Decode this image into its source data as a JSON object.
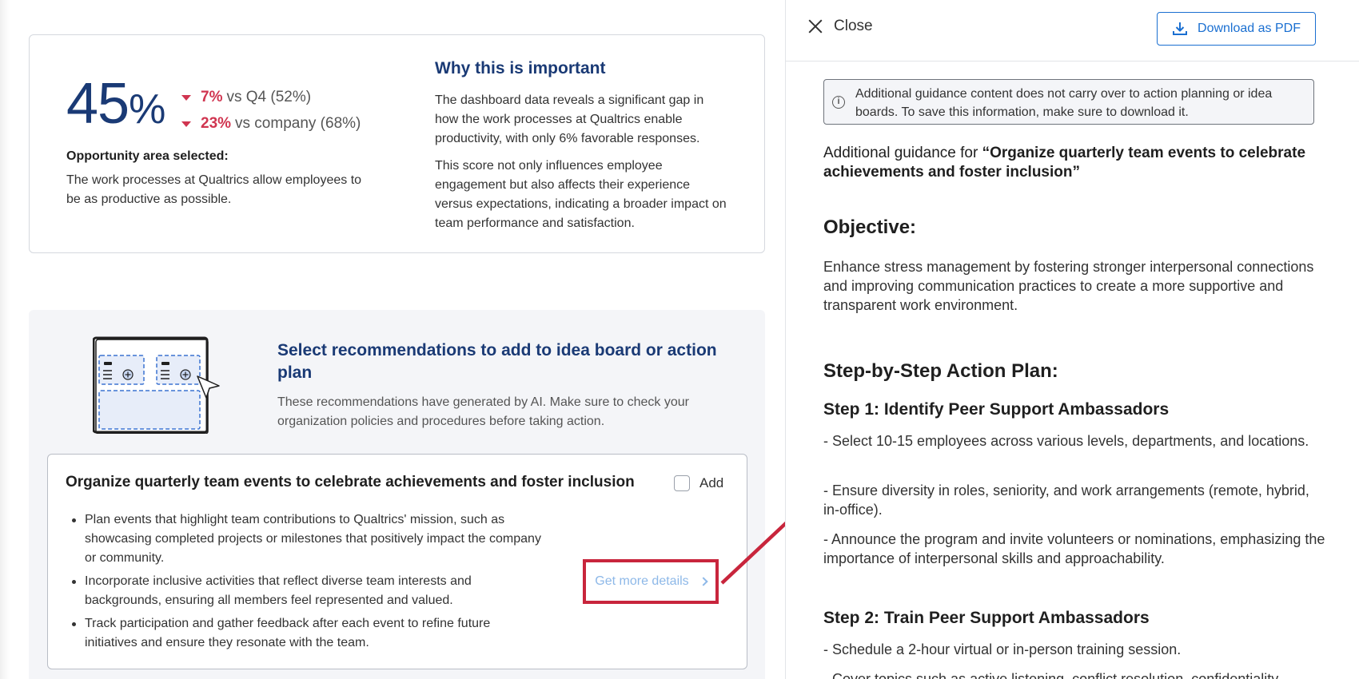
{
  "score_card": {
    "score": "45",
    "percent_sign": "%",
    "deltas": [
      {
        "value": "7%",
        "label": "vs Q4 (52%)"
      },
      {
        "value": "23%",
        "label": "vs company (68%)"
      }
    ],
    "opportunity_title": "Opportunity area selected:",
    "opportunity_text": "The work processes at Qualtrics allow employees to be as productive as possible.",
    "why_title": "Why this is important",
    "why_paragraph_1": "The dashboard data reveals a significant gap in how the work processes at Qualtrics enable productivity, with only 6% favorable responses.",
    "why_paragraph_2": "This score not only influences employee engagement but also affects their experience versus expectations, indicating a broader impact on team performance and satisfaction."
  },
  "recommendations": {
    "title": "Select recommendations to add to idea board or action plan",
    "subtitle": "These recommendations have generated by AI. Make sure to check your organization policies and procedures before taking action.",
    "card": {
      "title": "Organize quarterly team events to celebrate achievements and foster inclusion",
      "add_label": "Add",
      "bullets": [
        "Plan events that highlight team contributions to Qualtrics' mission, such as showcasing completed projects or milestones that positively impact the company or community.",
        "Incorporate inclusive activities that reflect diverse team interests and backgrounds, ensuring all members feel represented and valued.",
        "Track participation and gather feedback after each event to refine future initiatives and ensure they resonate with the team."
      ],
      "details_label": "Get more details"
    }
  },
  "side_panel": {
    "close_label": "Close",
    "download_label": "Download as PDF",
    "notice": "Additional guidance content does not carry over to action planning or idea boards. To save this information, make sure to download it.",
    "guidance_prefix": "Additional guidance for ",
    "guidance_quote": "“Organize quarterly team events to celebrate achievements and foster inclusion”",
    "objective_heading": "Objective:",
    "objective_text": "Enhance stress management by fostering stronger interpersonal connections and improving communication practices to create a more supportive and transparent work environment.",
    "plan_heading": "Step-by-Step Action Plan:",
    "step1_heading": "Step 1: Identify Peer Support Ambassadors",
    "step1_items": [
      "- Select 10-15 employees across various levels, departments, and locations.",
      "- Ensure diversity in roles, seniority, and work arrangements (remote, hybrid, in-office).",
      "- Announce the program and invite volunteers or nominations, emphasizing the importance of interpersonal skills and approachability."
    ],
    "step2_heading": "Step 2: Train Peer Support Ambassadors",
    "step2_items": [
      "- Schedule a 2-hour virtual or in-person training session.",
      "- Cover topics such as active listening, conflict resolution, confidentiality"
    ]
  },
  "colors": {
    "navy": "#1a3a75",
    "negative": "#d03550",
    "link_blue": "#1a6fd1",
    "highlight_red": "#c8253c"
  }
}
